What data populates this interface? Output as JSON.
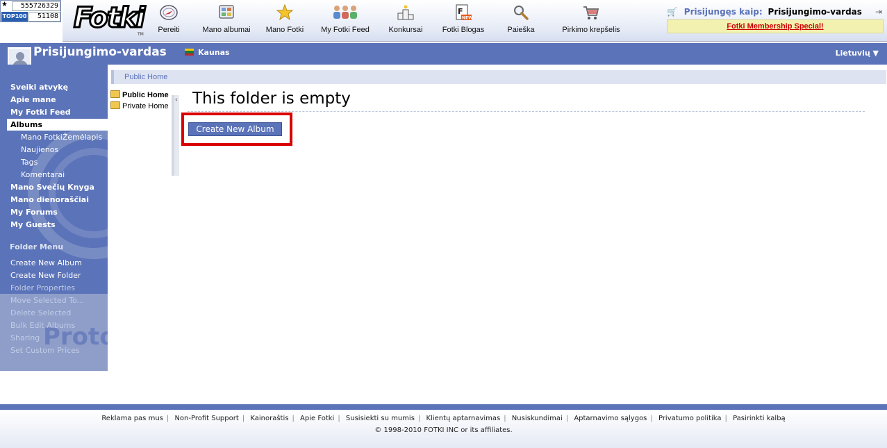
{
  "counter": {
    "total": "555726329",
    "badge": "TOP100",
    "today": "51108"
  },
  "logo": {
    "text": "Fotki",
    "tm": "TM"
  },
  "topnav": [
    {
      "label": "Pereiti",
      "icon": "compass-icon"
    },
    {
      "label": "Mano albumai",
      "icon": "albums-icon"
    },
    {
      "label": "Mano Fotki",
      "icon": "star-icon"
    },
    {
      "label": "My Fotki Feed",
      "icon": "people-feed-icon"
    },
    {
      "label": "Konkursai",
      "icon": "podium-icon"
    },
    {
      "label": "Fotki Blogas",
      "icon": "blog-new-icon"
    },
    {
      "label": "Paieška",
      "icon": "magnifier-icon"
    },
    {
      "label": "Pirkimo krepšelis",
      "icon": "cart-icon"
    }
  ],
  "login": {
    "label": "Prisijungęs kaip:",
    "name": "Prisijungimo-vardas"
  },
  "special": "Fotki Membership Special!",
  "user": {
    "name": "Prisijungimo-vardas",
    "city": "Kaunas",
    "language": "Lietuvių"
  },
  "sidebar": {
    "items": [
      "Sveiki atvykę",
      "Apie mane",
      "My Fotki Feed",
      "Albums",
      "Mano FotkiŽemėlapis",
      "Naujienos",
      "Tags",
      "Komentarai",
      "Mano Svečių Knyga",
      "Mano dienoraščiai",
      "My Forums",
      "My Guests"
    ],
    "folder_menu_title": "Folder Menu",
    "folder_menu": [
      "Create New Album",
      "Create New Folder",
      "Folder Properties",
      "Move Selected To...",
      "Delete Selected",
      "Bulk Edit Albums",
      "Sharing",
      "Set Custom Prices"
    ],
    "watermark": "Proto"
  },
  "breadcrumb": "Public Home",
  "tree": [
    "Public Home",
    "Private Home"
  ],
  "main": {
    "title": "This folder is empty",
    "create_button": "Create New Album"
  },
  "footer": {
    "links": [
      "Reklama pas mus",
      "Non-Profit Support",
      "Kainoraštis",
      "Apie Fotki",
      "Susisiekti su mumis",
      "Klientų aptarnavimas",
      "Nusiskundimai",
      "Aptarnavimo sąlygos",
      "Privatumo politika",
      "Pasirinkti kalbą"
    ],
    "copyright": "© 1998-2010 FOTKI INC or its affiliates."
  }
}
